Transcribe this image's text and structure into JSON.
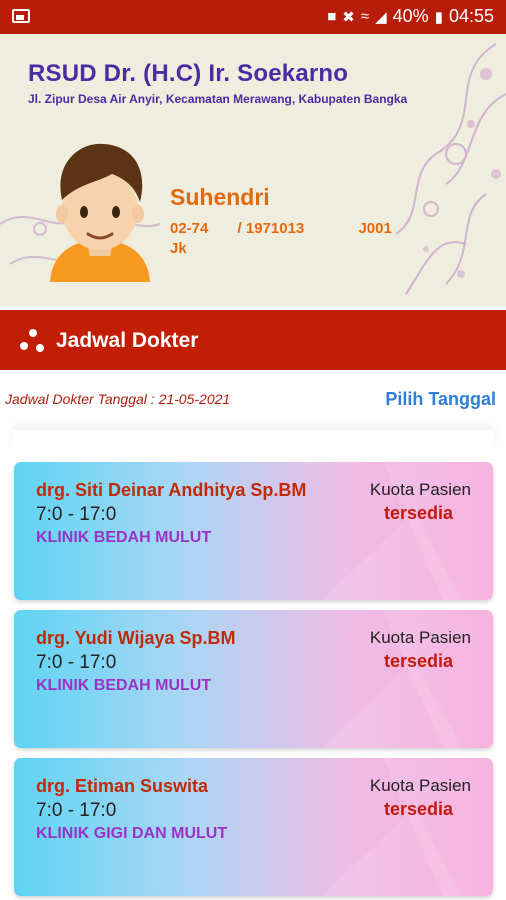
{
  "status_bar": {
    "battery": "40%",
    "time": "04:55"
  },
  "header": {
    "hospital_name": "RSUD Dr. (H.C) Ir. Soekarno",
    "hospital_address": "Jl. Zipur Desa Air Anyir, Kecamatan Merawang, Kabupaten Bangka",
    "patient_name": "Suhendri",
    "patient_id": "02-74       / 1971013             J001",
    "patient_jk": "Jk"
  },
  "titlebar": {
    "title": "Jadwal Dokter"
  },
  "date_row": {
    "label": "Jadwal Dokter Tanggal : 21-05-2021",
    "pick_button": "Pilih Tanggal"
  },
  "doctors": [
    {
      "name": "drg. Siti Deinar Andhitya Sp.BM",
      "time": "7:0 - 17:0",
      "clinic": "KLINIK BEDAH MULUT",
      "quota_label": "Kuota Pasien",
      "quota_status": "tersedia"
    },
    {
      "name": "drg. Yudi Wijaya Sp.BM",
      "time": "7:0 - 17:0",
      "clinic": "KLINIK BEDAH MULUT",
      "quota_label": "Kuota Pasien",
      "quota_status": "tersedia"
    },
    {
      "name": "drg. Etiman Suswita",
      "time": "7:0 - 17:0",
      "clinic": "KLINIK GIGI DAN MULUT",
      "quota_label": "Kuota Pasien",
      "quota_status": "tersedia"
    }
  ],
  "colors": {
    "primary_red": "#c21e05",
    "purple": "#4a2da2",
    "orange": "#e3690d",
    "link_blue": "#2f7fd8"
  }
}
